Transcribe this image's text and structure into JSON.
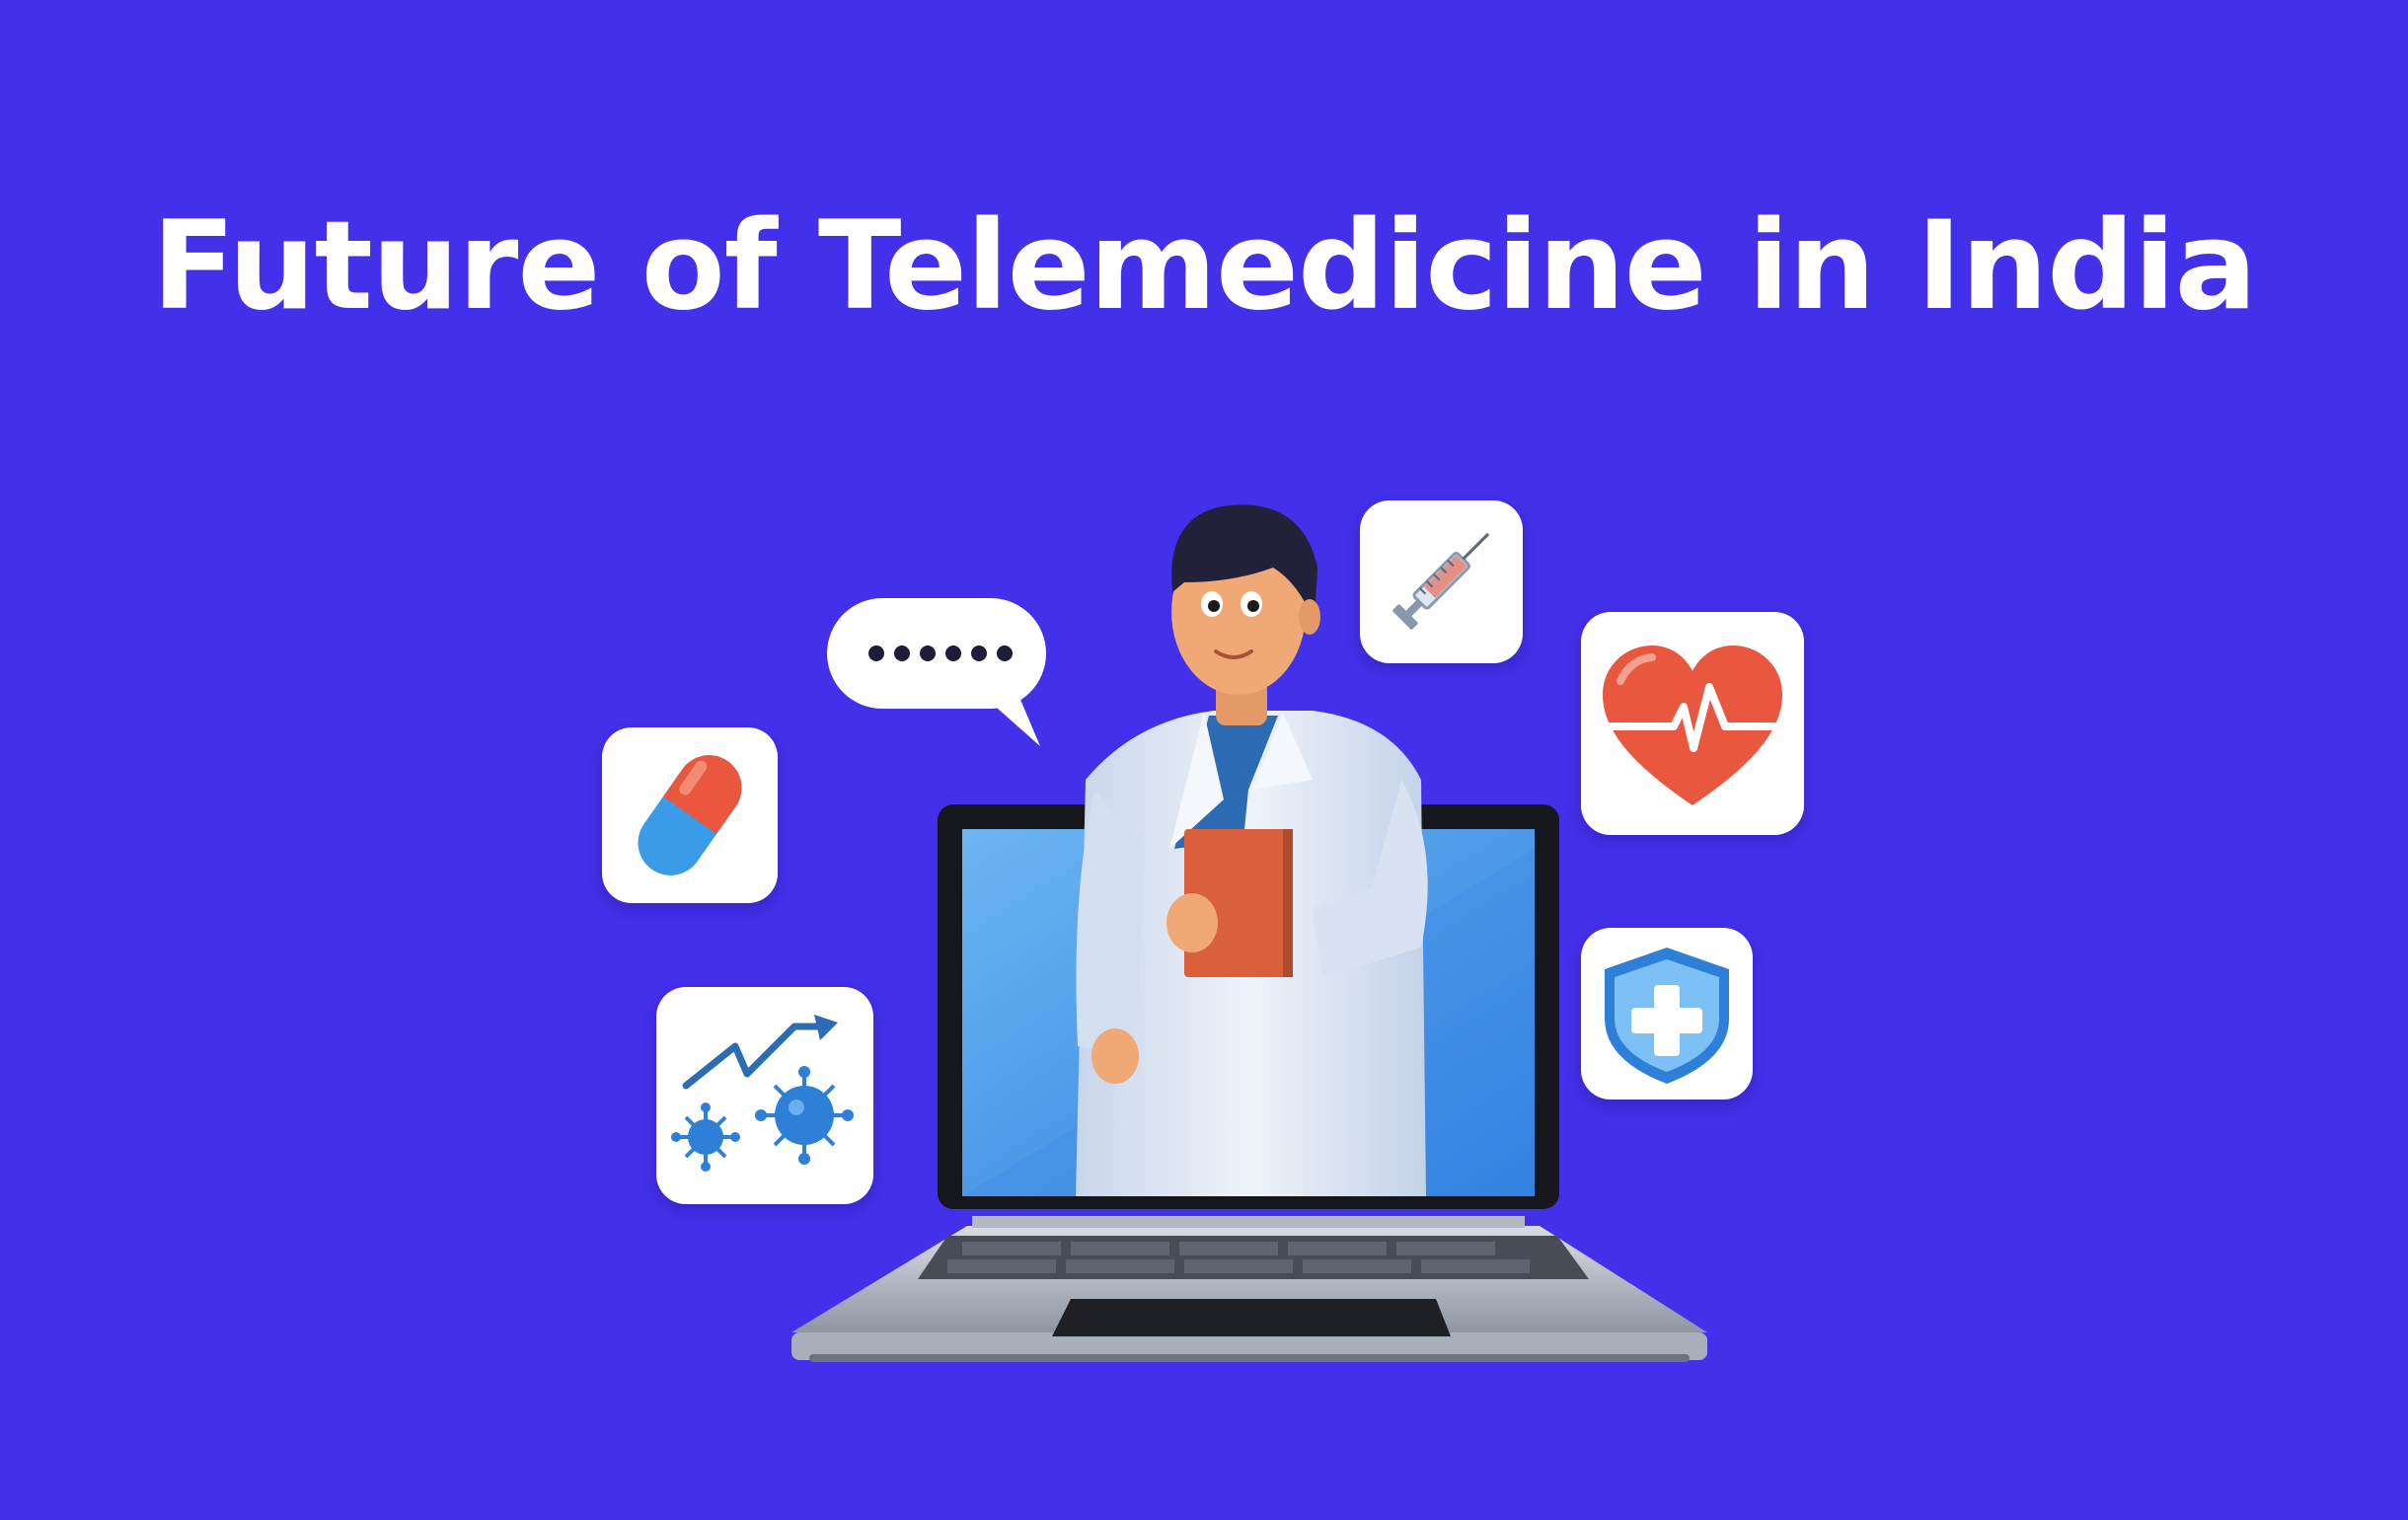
{
  "title": "Future of Telemedicine in India",
  "colors": {
    "background": "#4330EA",
    "title_text": "#FFFFFF",
    "card": "#FFFFFF",
    "screen": "#4A90E8",
    "heart": "#E8573E",
    "capsule_red": "#E8573E",
    "capsule_blue": "#3A9BE8",
    "shield": "#4AA3F0",
    "coat": "#E4ECF7",
    "book": "#D9603A"
  },
  "illustration": {
    "figure": "doctor-in-laptop",
    "icons": [
      "speech-bubble-icon",
      "capsule-icon",
      "syringe-icon",
      "heart-rate-icon",
      "shield-cross-icon",
      "virus-trend-icon"
    ]
  }
}
